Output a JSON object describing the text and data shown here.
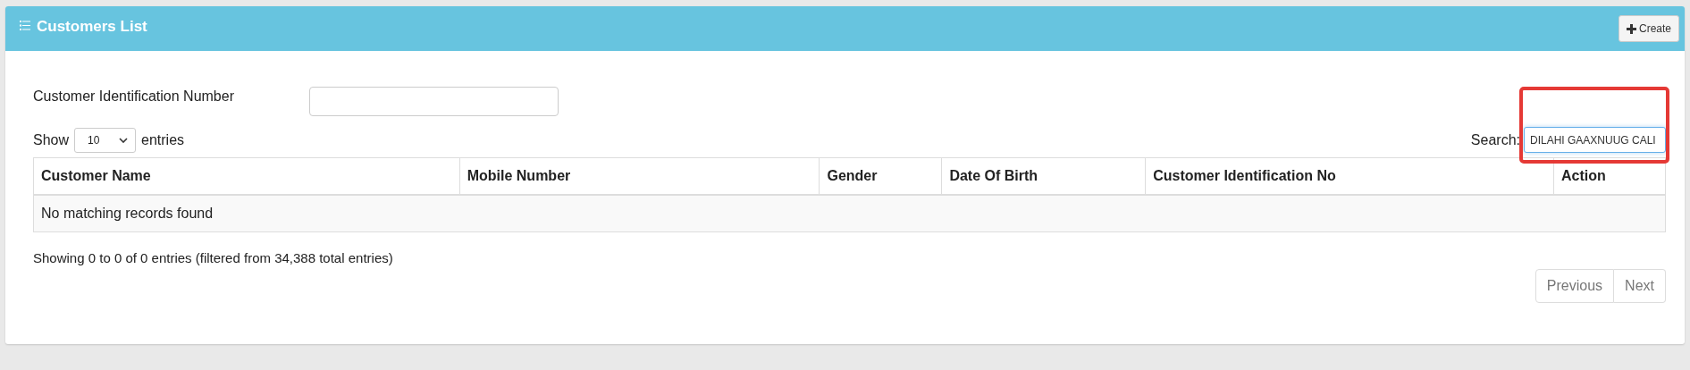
{
  "panel": {
    "title": "Customers List",
    "create_button": "Create"
  },
  "filter": {
    "label": "Customer Identification Number"
  },
  "length": {
    "show": "Show",
    "value": "10",
    "suffix": "entries"
  },
  "search": {
    "label": "Search:",
    "value": "DILAHI GAAXNUUG CALI",
    "highlighted": true
  },
  "table": {
    "columns": [
      {
        "label": "Customer Name"
      },
      {
        "label": "Mobile Number"
      },
      {
        "label": "Gender"
      },
      {
        "label": "Date Of Birth"
      },
      {
        "label": "Customer Identification No"
      },
      {
        "label": "Action"
      }
    ],
    "empty_message": "No matching records found"
  },
  "info": "Showing 0 to 0 of 0 entries (filtered from 34,388 total entries)",
  "pagination": [
    {
      "label": "Previous",
      "disabled": true
    },
    {
      "label": "Next",
      "disabled": true
    }
  ]
}
